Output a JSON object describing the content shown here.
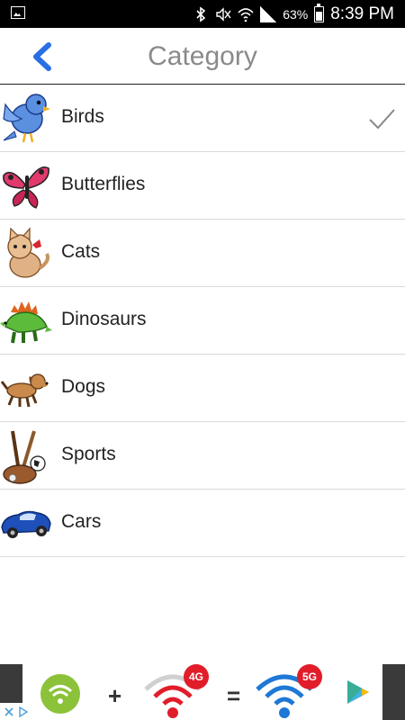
{
  "status_bar": {
    "battery_percent": "63%",
    "time": "8:39 PM",
    "icons": [
      "image-icon",
      "bluetooth-icon",
      "mute-icon",
      "wifi-icon",
      "signal-icon",
      "battery-icon"
    ]
  },
  "header": {
    "title": "Category",
    "back_icon": "chevron-left-icon",
    "accent": "#2a6fe3"
  },
  "categories": [
    {
      "label": "Birds",
      "icon": "bird-icon",
      "selected": true
    },
    {
      "label": "Butterflies",
      "icon": "butterfly-icon",
      "selected": false
    },
    {
      "label": "Cats",
      "icon": "cat-icon",
      "selected": false
    },
    {
      "label": "Dinosaurs",
      "icon": "dinosaur-icon",
      "selected": false
    },
    {
      "label": "Dogs",
      "icon": "dog-icon",
      "selected": false
    },
    {
      "label": "Sports",
      "icon": "sports-icon",
      "selected": false
    },
    {
      "label": "Cars",
      "icon": "car-icon",
      "selected": false
    }
  ],
  "ad": {
    "badge_1": "4G",
    "badge_2": "5G",
    "plus": "+",
    "equals": "=",
    "icons": [
      "ad-choices-icon",
      "wifi-app-icon",
      "wifi-4g-icon",
      "wifi-5g-icon",
      "play-store-icon"
    ]
  }
}
